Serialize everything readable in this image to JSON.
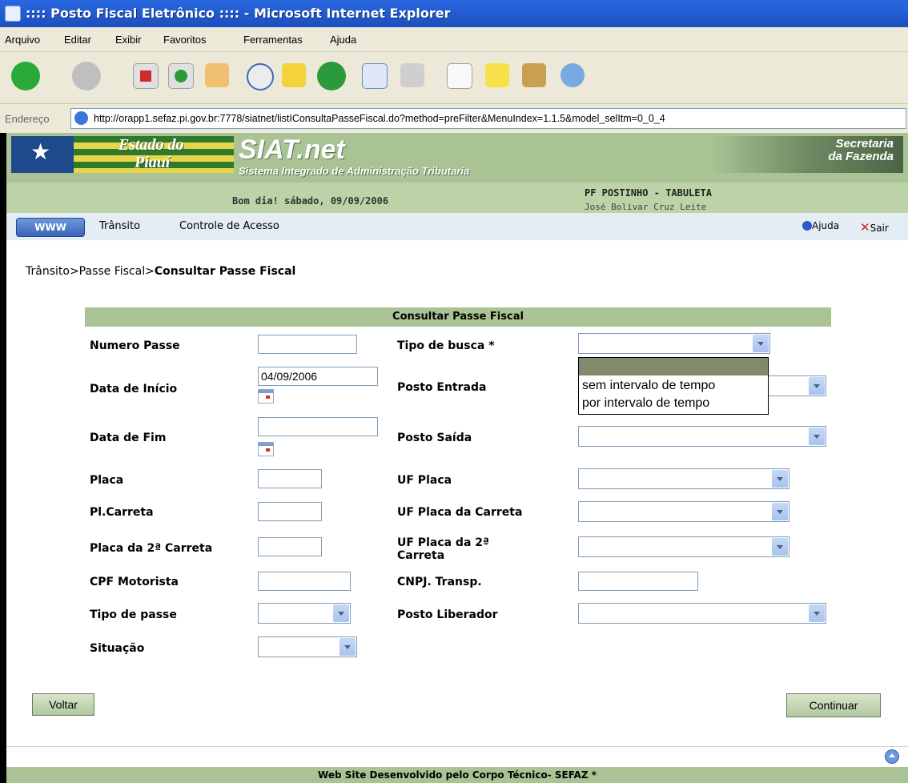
{
  "window": {
    "title": ":::: Posto Fiscal Eletrônico :::: - Microsoft Internet Explorer"
  },
  "menu": [
    "Arquivo",
    "Editar",
    "Exibir",
    "Favoritos",
    "Ferramentas",
    "Ajuda"
  ],
  "toolbar": {
    "icons": [
      "back-icon",
      "forward-icon",
      "stop-icon",
      "refresh-icon",
      "home-icon",
      "search-icon",
      "favorites-icon",
      "history-icon",
      "mail-icon",
      "print-icon",
      "edit-icon",
      "discuss-icon",
      "folder-icon",
      "messenger-icon"
    ]
  },
  "address": {
    "label": "Endereço",
    "url": "http://orapp1.sefaz.pi.gov.br:7778/siatnet/listIConsultaPasseFiscal.do?method=preFilter&MenuIndex=1.1.5&model_selItm=0_0_4"
  },
  "banner": {
    "estado_line1": "Estado do",
    "estado_line2": "Piauí",
    "siat": "SIAT.net",
    "siat_sub": "Sistema Integrado de Administração Tributaria",
    "secretaria_line1": "Secretaria",
    "secretaria_line2": "da Fazenda",
    "greeting": "Bom dia! sábado, 09/09/2006",
    "posto": "PF POSTINHO - TABULETA",
    "user": "José Bolivar Cruz Leite"
  },
  "nav": {
    "home": "WWW",
    "items": [
      "Trânsito",
      "Controle de Acesso"
    ],
    "help": "Ajuda",
    "exit": "Sair"
  },
  "breadcrumb": {
    "path": "Trânsito>Passe Fiscal>",
    "current": "Consultar Passe Fiscal"
  },
  "form": {
    "title": "Consultar Passe Fiscal",
    "numero_passe": {
      "label": "Numero Passe",
      "value": ""
    },
    "data_inicio": {
      "label": "Data de Início",
      "value": "04/09/2006"
    },
    "data_fim": {
      "label": "Data de Fim",
      "value": ""
    },
    "placa": {
      "label": "Placa",
      "value": ""
    },
    "pl_carreta": {
      "label": "Pl.Carreta",
      "value": ""
    },
    "placa_2_carreta": {
      "label": "Placa da 2ª Carreta",
      "value": ""
    },
    "cpf_motorista": {
      "label": "CPF Motorista",
      "value": ""
    },
    "tipo_passe": {
      "label": "Tipo de passe",
      "value": ""
    },
    "situacao": {
      "label": "Situação",
      "value": ""
    },
    "tipo_busca": {
      "label": "Tipo de busca *",
      "value": "",
      "options": [
        "",
        "sem intervalo de tempo",
        "por intervalo de tempo"
      ]
    },
    "posto_entrada": {
      "label": "Posto Entrada",
      "value": ""
    },
    "posto_saida": {
      "label": "Posto Saída",
      "value": ""
    },
    "uf_placa": {
      "label": "UF Placa",
      "value": ""
    },
    "uf_placa_carreta": {
      "label": "UF Placa da Carreta",
      "value": ""
    },
    "uf_placa_2_carreta": {
      "label_line1": "UF Placa da 2ª",
      "label_line2": "Carreta",
      "value": ""
    },
    "cnpj_transp": {
      "label": "CNPJ. Transp.",
      "value": ""
    },
    "posto_liberador": {
      "label": "Posto Liberador",
      "value": ""
    }
  },
  "buttons": {
    "back": "Voltar",
    "continue": "Continuar"
  },
  "footer": "Web Site Desenvolvido pelo Corpo Técnico- SEFAZ *"
}
